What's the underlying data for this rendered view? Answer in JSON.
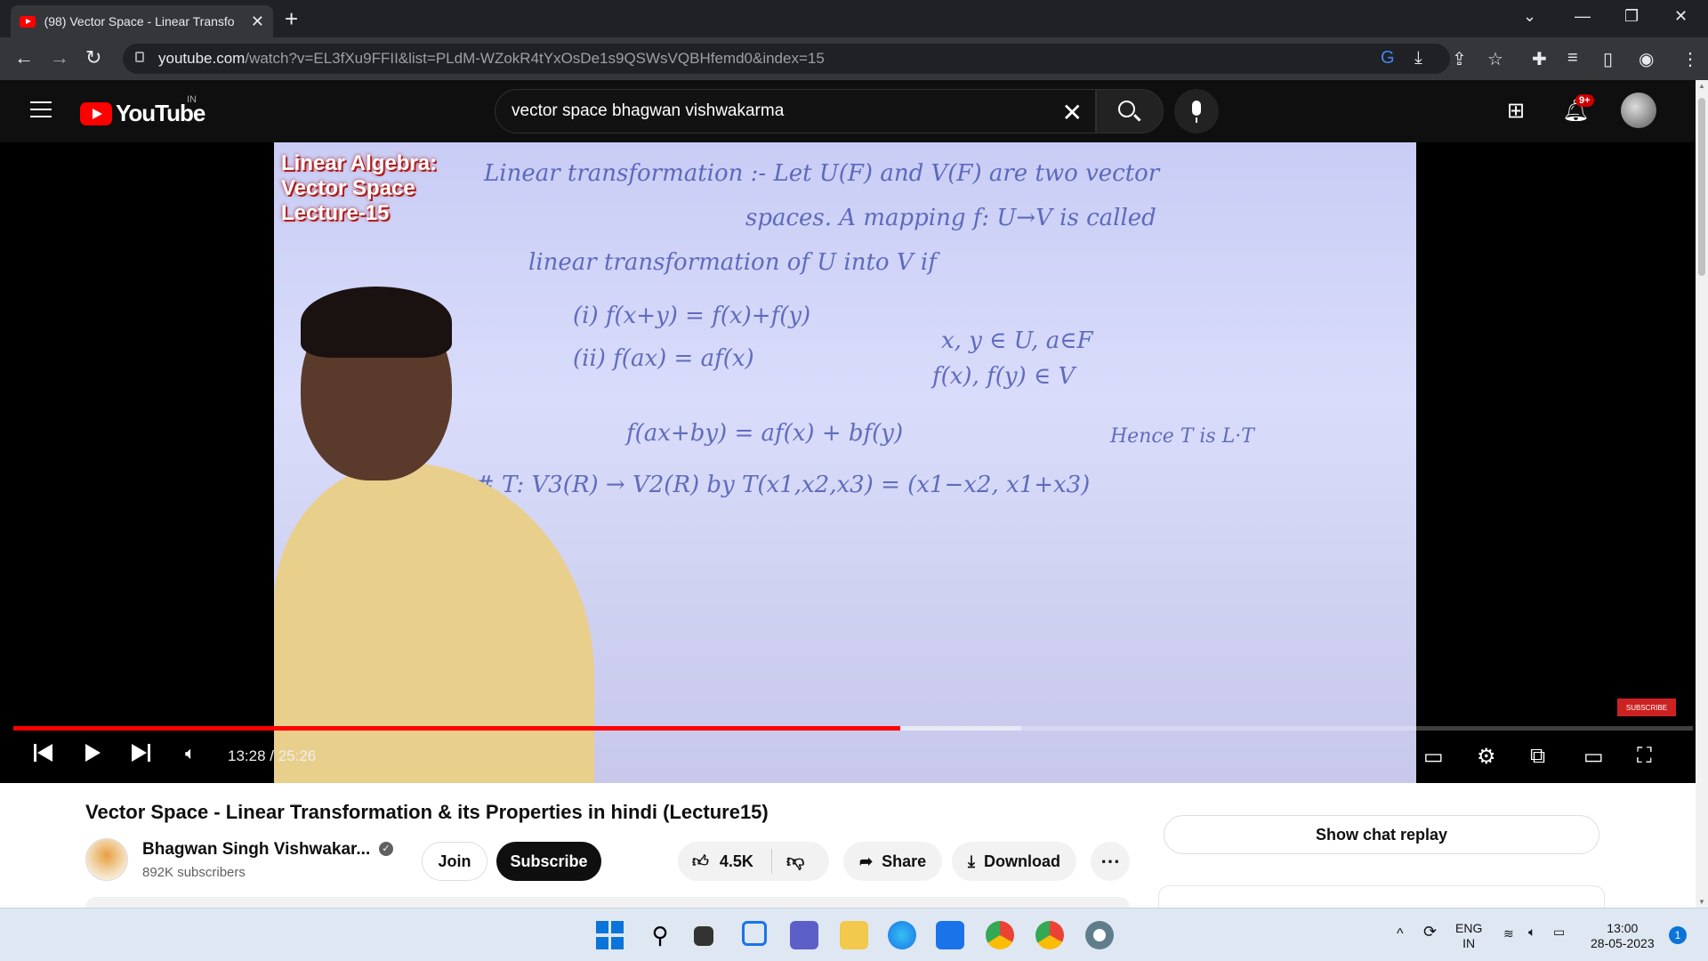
{
  "browser": {
    "tab_title": "(98) Vector Space - Linear Transfo",
    "url_host": "youtube.com",
    "url_path": "/watch?v=EL3fXu9FFII&list=PLdM-WZokR4tYxOsDe1s9QSWsVQBHfemd0&index=15"
  },
  "youtube": {
    "logo_text": "YouTube",
    "country_code": "IN",
    "search_query": "vector space bhagwan vishwakarma",
    "notification_count": "9+"
  },
  "video": {
    "overlay_title": [
      "Linear Algebra:",
      "Vector Space",
      "Lecture-15"
    ],
    "board_lines": [
      "Linear transformation :- Let U(F) and V(F) are two vector",
      "spaces. A mapping f: U→V is called",
      "linear transformation of U into V if",
      "(i) f(x+y) = f(x)+f(y)",
      "x, y ∈ U, a∈F",
      "(ii) f(ax) = af(x)",
      "f(x), f(y) ∈ V",
      "f(ax+by) = af(x) + bf(y)",
      "Hence T is L·T",
      "# T: V3(R) → V2(R) by T(x1,x2,x3) = (x1−x2, x1+x3)"
    ],
    "current_time": "13:28",
    "duration": "25:26",
    "played_fraction": 0.528,
    "loaded_fraction": 0.6,
    "watermark": "SUBSCRIBE"
  },
  "below": {
    "video_title": "Vector Space - Linear Transformation & its Properties in hindi (Lecture15)",
    "channel_name": "Bhagwan Singh Vishwakar...",
    "subscribers": "892K subscribers",
    "join_label": "Join",
    "subscribe_label": "Subscribe",
    "likes": "4.5K",
    "share_label": "Share",
    "download_label": "Download",
    "chat_replay_label": "Show chat replay"
  },
  "taskbar": {
    "lang_top": "ENG",
    "lang_bottom": "IN",
    "time": "13:00",
    "date": "28-05-2023",
    "notif_count": "1"
  }
}
